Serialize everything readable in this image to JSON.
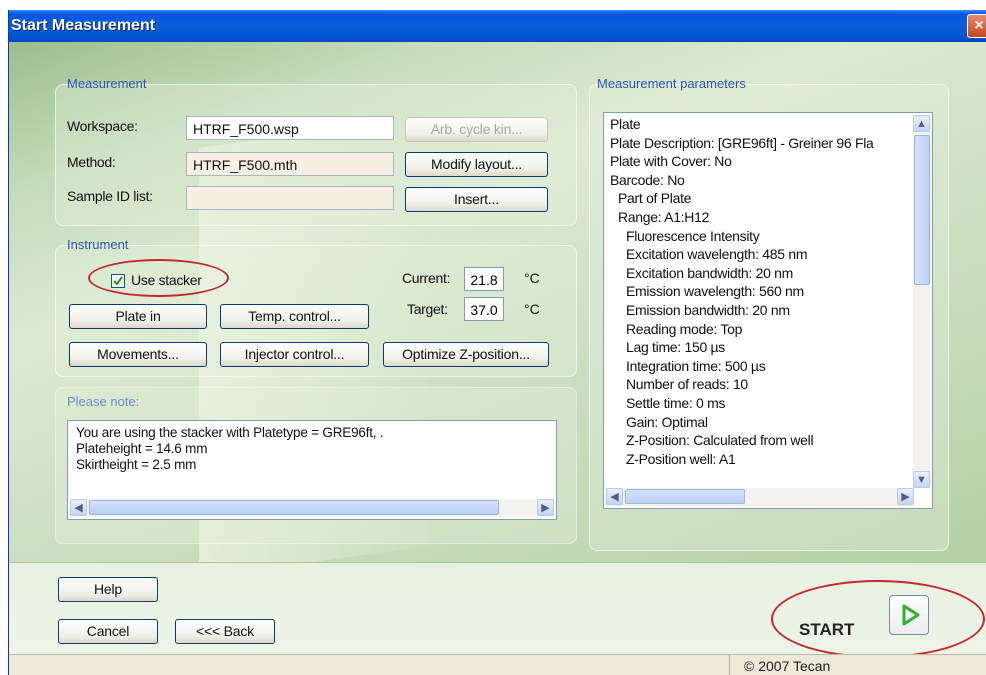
{
  "window": {
    "title": "Start Measurement",
    "close_symbol": "×"
  },
  "measurement": {
    "group_label": "Measurement",
    "workspace_label": "Workspace:",
    "workspace_value": "HTRF_F500.wsp",
    "method_label": "Method:",
    "method_value": "HTRF_F500.mth",
    "sample_label": "Sample ID list:",
    "sample_value": "",
    "arb_cycle_button": "Arb. cycle kin...",
    "modify_layout_button": "Modify layout...",
    "insert_button": "Insert..."
  },
  "instrument": {
    "group_label": "Instrument",
    "use_stacker_label": "Use stacker",
    "use_stacker_checked": true,
    "current_label": "Current:",
    "current_value": "21.8",
    "target_label": "Target:",
    "target_value": "37.0",
    "unit": "°C",
    "plate_in_button": "Plate in",
    "temp_control_button": "Temp. control...",
    "movements_button": "Movements...",
    "injector_control_button": "Injector control...",
    "optimize_z_button": "Optimize Z-position..."
  },
  "note": {
    "label": "Please note:",
    "lines": [
      "You are using the stacker with Platetype = GRE96ft, .",
      "Plateheight = 14.6 mm",
      "Skirtheight = 2.5 mm"
    ]
  },
  "parameters": {
    "label": "Measurement parameters",
    "lines": [
      {
        "text": "Plate",
        "indent": 0
      },
      {
        "text": "Plate Description: [GRE96ft] - Greiner 96 Fla",
        "indent": 0
      },
      {
        "text": "Plate with Cover: No",
        "indent": 0
      },
      {
        "text": "Barcode: No",
        "indent": 0
      },
      {
        "text": "Part of Plate",
        "indent": 1
      },
      {
        "text": "Range: A1:H12",
        "indent": 1
      },
      {
        "text": "Fluorescence Intensity",
        "indent": 2
      },
      {
        "text": "Excitation wavelength: 485 nm",
        "indent": 2
      },
      {
        "text": "Excitation bandwidth: 20 nm",
        "indent": 2
      },
      {
        "text": "Emission wavelength: 560 nm",
        "indent": 2
      },
      {
        "text": "Emission bandwidth: 20 nm",
        "indent": 2
      },
      {
        "text": "Reading mode: Top",
        "indent": 2
      },
      {
        "text": "Lag time: 150 µs",
        "indent": 2
      },
      {
        "text": "Integration time: 500 µs",
        "indent": 2
      },
      {
        "text": "Number of reads: 10",
        "indent": 2
      },
      {
        "text": "Settle time: 0 ms",
        "indent": 2
      },
      {
        "text": "Gain: Optimal",
        "indent": 2
      },
      {
        "text": "Z-Position: Calculated from well",
        "indent": 2
      },
      {
        "text": "Z-Position well: A1",
        "indent": 2
      }
    ]
  },
  "footer": {
    "help_button": "Help",
    "cancel_button": "Cancel",
    "back_button": "<<< Back",
    "start_label": "START",
    "status_copyright": "© 2007 Tecan"
  },
  "colors": {
    "title_bar": "#0054d4",
    "group_label": "#2b55b8",
    "highlight_ellipse": "#c52a2a",
    "start_arrow": "#2fae2f"
  }
}
